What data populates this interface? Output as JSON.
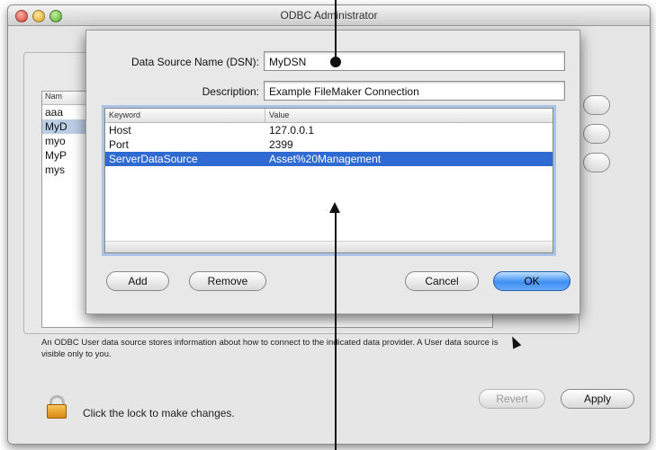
{
  "window": {
    "title": "ODBC Administrator"
  },
  "background": {
    "list_header": "Nam",
    "list_items": [
      "aaa",
      "MyD",
      "myo",
      "MyP",
      "mys"
    ],
    "description": "An ODBC User data source stores information about how to connect to the indicated data provider. A User data source is visible only to you.",
    "lock_text": "Click the lock to make changes.",
    "revert_label": "Revert",
    "apply_label": "Apply"
  },
  "dialog": {
    "dsn_label": "Data Source Name (DSN):",
    "dsn_value": "MyDSN",
    "description_label": "Description:",
    "description_value": "Example FileMaker Connection",
    "table": {
      "columns": [
        "Keyword",
        "Value"
      ],
      "rows": [
        {
          "keyword": "Host",
          "value": "127.0.0.1"
        },
        {
          "keyword": "Port",
          "value": "2399"
        },
        {
          "keyword": "ServerDataSource",
          "value": "Asset%20Management"
        }
      ],
      "selected_row": 2
    },
    "buttons": {
      "add": "Add",
      "remove": "Remove",
      "cancel": "Cancel",
      "ok": "OK"
    }
  },
  "colors": {
    "selection": "#2f6ad2",
    "default_button": "#3f8ff0"
  }
}
